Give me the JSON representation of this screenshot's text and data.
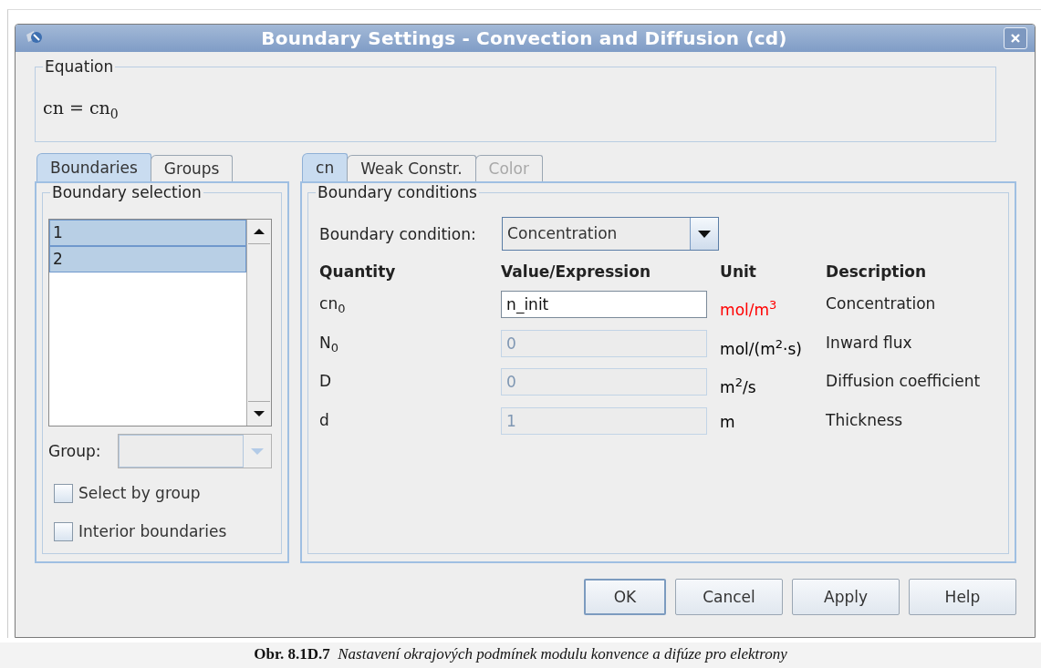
{
  "window": {
    "title": "Boundary Settings - Convection and Diffusion (cd)"
  },
  "equation": {
    "legend": "Equation",
    "formula": "cn = cn$_{0}$"
  },
  "left_tabs": [
    {
      "label": "Boundaries",
      "selected": true
    },
    {
      "label": "Groups",
      "selected": false
    }
  ],
  "boundary_selection": {
    "legend": "Boundary selection",
    "items": [
      {
        "label": "1",
        "selected": true
      },
      {
        "label": "2",
        "selected": true
      }
    ]
  },
  "group": {
    "label": "Group:",
    "disabled": true
  },
  "checkboxes": [
    {
      "label": "Select by group",
      "checked": false
    },
    {
      "label": "Interior boundaries",
      "checked": false
    }
  ],
  "right_tabs": [
    {
      "label": "cn",
      "selected": true,
      "disabled": false
    },
    {
      "label": "Weak Constr.",
      "selected": false,
      "disabled": false
    },
    {
      "label": "Color",
      "selected": false,
      "disabled": true
    }
  ],
  "boundary_conditions": {
    "legend": "Boundary conditions",
    "condition_label": "Boundary condition:",
    "condition_value": "Concentration",
    "columns": [
      "Quantity",
      "Value/Expression",
      "Unit",
      "Description"
    ],
    "rows": [
      {
        "quantity": "cn$_{0}$",
        "value": "n_init",
        "disabled": false,
        "unit": "mol/m$^{3}$",
        "color": "#ff0000",
        "description": "Concentration"
      },
      {
        "quantity": "N$_{0}$",
        "value": "0",
        "disabled": true,
        "unit": "mol/(m$^{2}$·s)",
        "color": "#000000",
        "description": "Inward flux"
      },
      {
        "quantity": "D",
        "value": "0",
        "disabled": true,
        "unit": "m$^{2}$/s",
        "color": "#000000",
        "description": "Diffusion coefficient"
      },
      {
        "quantity": "d",
        "value": "1",
        "disabled": true,
        "unit": "m",
        "color": "#000000",
        "description": "Thickness"
      }
    ]
  },
  "buttons": [
    {
      "label": "OK",
      "default": true
    },
    {
      "label": "Cancel",
      "default": false
    },
    {
      "label": "Apply",
      "default": false
    },
    {
      "label": "Help",
      "default": false
    }
  ],
  "caption": {
    "label": "Obr. 8.1D.7",
    "text": "Nastavení okrajových podmínek modulu konvence a difúze pro elektrony"
  }
}
